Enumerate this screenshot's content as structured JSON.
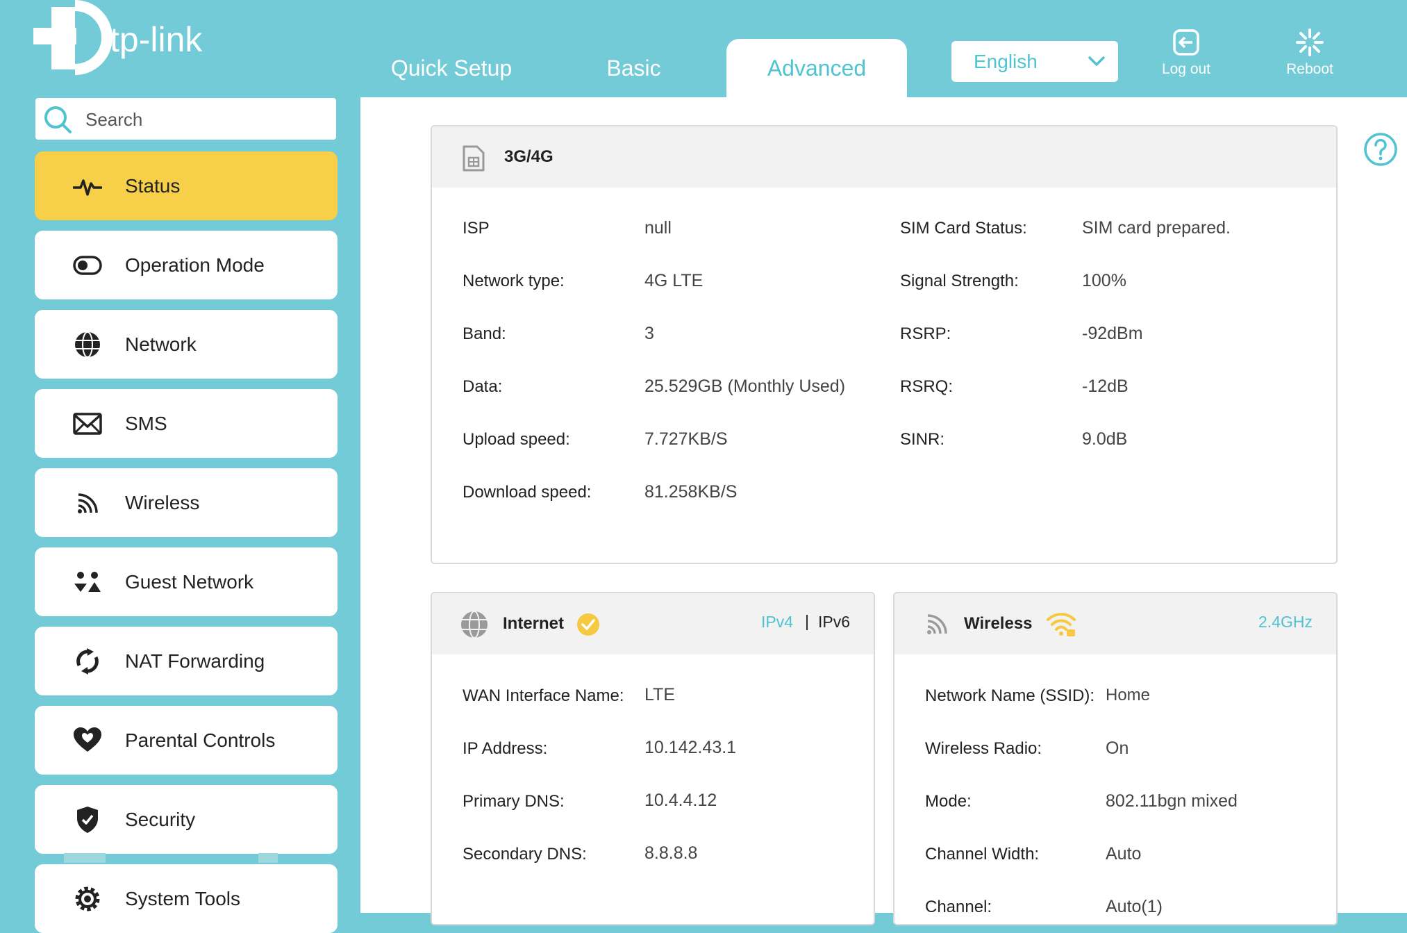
{
  "brand": {
    "logo_text": "tp-link"
  },
  "nav": {
    "tabs": [
      {
        "label": "Quick Setup"
      },
      {
        "label": "Basic"
      },
      {
        "label": "Advanced"
      }
    ],
    "active_tab": "Advanced",
    "language": "English",
    "logout_label": "Log out",
    "reboot_label": "Reboot"
  },
  "sidebar": {
    "search_placeholder": "Search",
    "items": [
      {
        "label": "Status",
        "icon": "pulse-icon",
        "active": true
      },
      {
        "label": "Operation Mode",
        "icon": "toggle-icon"
      },
      {
        "label": "Network",
        "icon": "globe-icon"
      },
      {
        "label": "SMS",
        "icon": "envelope-icon"
      },
      {
        "label": "Wireless",
        "icon": "wifi-signal-icon"
      },
      {
        "label": "Guest Network",
        "icon": "guests-icon"
      },
      {
        "label": "NAT Forwarding",
        "icon": "nat-arrows-icon"
      },
      {
        "label": "Parental Controls",
        "icon": "heart-icon"
      },
      {
        "label": "Security",
        "icon": "shield-icon"
      },
      {
        "label": "System Tools",
        "icon": "gear-icon"
      }
    ]
  },
  "cellular": {
    "title": "3G/4G",
    "rows": [
      {
        "label": "ISP",
        "value": "null"
      },
      {
        "label": "Network type:",
        "value": "4G LTE"
      },
      {
        "label": "Band:",
        "value": "3"
      },
      {
        "label": "Data:",
        "value": "25.529GB (Monthly Used)"
      },
      {
        "label": "Upload speed:",
        "value": "7.727KB/S"
      },
      {
        "label": "Download speed:",
        "value": "81.258KB/S"
      }
    ],
    "rows_right": [
      {
        "label": "SIM Card Status:",
        "value": "SIM card prepared."
      },
      {
        "label": "Signal Strength:",
        "value": "100%"
      },
      {
        "label": "RSRP:",
        "value": "-92dBm"
      },
      {
        "label": "RSRQ:",
        "value": "-12dB"
      },
      {
        "label": "SINR:",
        "value": "9.0dB"
      }
    ]
  },
  "internet": {
    "title": "Internet",
    "ipv4": "IPv4",
    "separator": "|",
    "ipv6": "IPv6",
    "rows": [
      {
        "label": "WAN Interface Name:",
        "value": "LTE"
      },
      {
        "label": "IP Address:",
        "value": "10.142.43.1"
      },
      {
        "label": "Primary DNS:",
        "value": "10.4.4.12"
      },
      {
        "label": "Secondary DNS:",
        "value": "8.8.8.8"
      }
    ]
  },
  "wireless": {
    "title": "Wireless",
    "band": "2.4GHz",
    "rows": [
      {
        "label": "Network Name (SSID):",
        "value": "Home"
      },
      {
        "label": "Wireless Radio:",
        "value": "On"
      },
      {
        "label": "Mode:",
        "value": "802.11bgn mixed"
      },
      {
        "label": "Channel Width:",
        "value": "Auto"
      },
      {
        "label": "Channel:",
        "value": "Auto(1)"
      }
    ]
  },
  "colors": {
    "header_bg": "#72cbd6",
    "accent": "#4fc3cf",
    "active_menu": "#f7cf48",
    "status_ok": "#f7c842"
  }
}
